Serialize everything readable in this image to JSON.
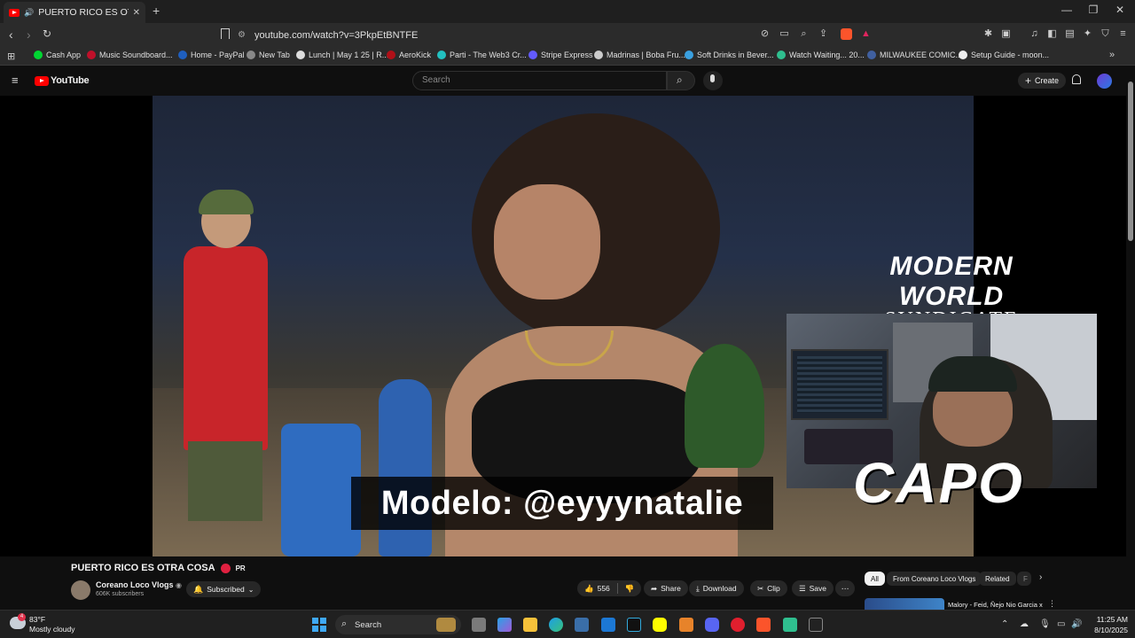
{
  "browser": {
    "tab_title": "PUERTO RICO ES OTRA COSA",
    "new_tab": "+",
    "close_tab": "✕",
    "url": "youtube.com/watch?v=3PkpEtBNTFE",
    "window": {
      "minimize": "—",
      "restore": "❐",
      "close": "✕"
    }
  },
  "bookmarks": [
    {
      "label": "Cash App",
      "color": "#00d632"
    },
    {
      "label": "Music Soundboard...",
      "color": "#c0102a"
    },
    {
      "label": "Home - PayPal",
      "color": "#1f5fbf"
    },
    {
      "label": "New Tab",
      "color": "#888888"
    },
    {
      "label": "Lunch | May 1 25 | R...",
      "color": "#dddddd"
    },
    {
      "label": "AeroKick",
      "color": "#b01018"
    },
    {
      "label": "Parti - The Web3 Cr...",
      "color": "#22c0c0"
    },
    {
      "label": "Stripe Express",
      "color": "#635bff"
    },
    {
      "label": "Madrinas | Boba Fru...",
      "color": "#cccccc"
    },
    {
      "label": "Soft Drinks in Bever...",
      "color": "#3aa0e0"
    },
    {
      "label": "Watch Waiting... 20...",
      "color": "#2fbf8f"
    },
    {
      "label": "MILWAUKEE COMIC...",
      "color": "#4060a0"
    },
    {
      "label": "Setup Guide - moon...",
      "color": "#eeeeee"
    }
  ],
  "youtube": {
    "logo_text": "YouTube",
    "search_placeholder": "Search",
    "create_label": "Create"
  },
  "video": {
    "caption": "Modelo: @eyyynatalie",
    "brand_line1": "MODERN WORLD",
    "brand_line2": "SYNDICATE",
    "streamer_tag": "CAPO"
  },
  "details": {
    "title": "PUERTO RICO ES OTRA COSA",
    "title_suffix": "PR",
    "channel": "Coreano Loco Vlogs",
    "subscribers": "606K subscribers",
    "subscribed_label": "Subscribed",
    "likes": "556",
    "share": "Share",
    "download": "Download",
    "clip": "Clip",
    "save": "Save",
    "more": "⋯"
  },
  "chips": [
    {
      "label": "All",
      "active": true
    },
    {
      "label": "From Coreano Loco Vlogs"
    },
    {
      "label": "Related"
    },
    {
      "label": "F"
    }
  ],
  "related": {
    "title": "Malory - Feid, Ñejo Nio Garcia x"
  },
  "taskbar": {
    "weather_temp": "83°F",
    "weather_desc": "Mostly cloudy",
    "search_label": "Search",
    "time": "11:25 AM",
    "date": "8/10/2025"
  }
}
